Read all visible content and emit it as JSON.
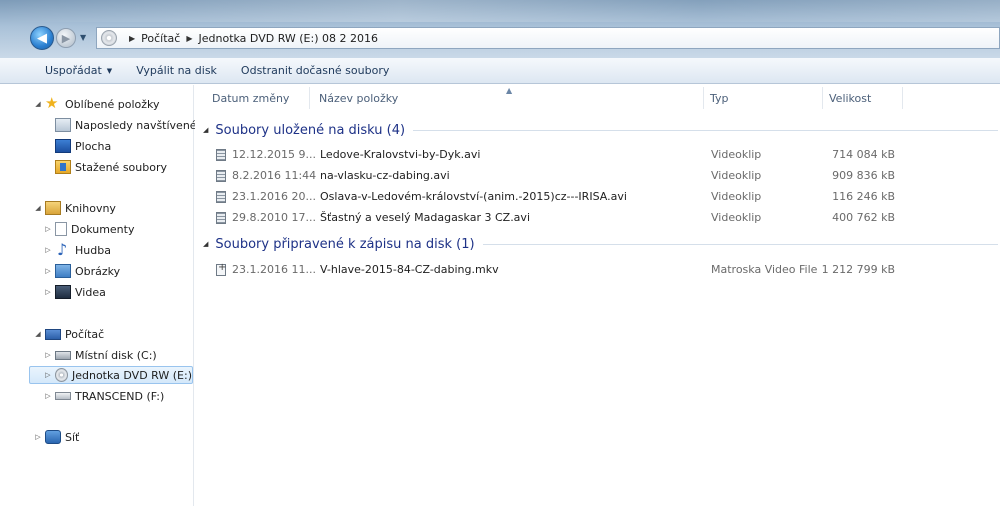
{
  "address": {
    "crumbs": [
      "Počítač",
      "Jednotka DVD RW (E:) 08 2 2016"
    ]
  },
  "toolbar": {
    "organize": "Uspořádat",
    "burn": "Vypálit na disk",
    "delete_temp": "Odstranit dočasné soubory"
  },
  "nav": {
    "favorites": {
      "label": "Oblíbené položky",
      "items": [
        {
          "label": "Naposledy navštívené",
          "icon": "recent-places-icon"
        },
        {
          "label": "Plocha",
          "icon": "desktop-icon"
        },
        {
          "label": "Stažené soubory",
          "icon": "downloads-icon"
        }
      ]
    },
    "libraries": {
      "label": "Knihovny",
      "items": [
        {
          "label": "Dokumenty",
          "icon": "documents-icon"
        },
        {
          "label": "Hudba",
          "icon": "music-icon"
        },
        {
          "label": "Obrázky",
          "icon": "pictures-icon"
        },
        {
          "label": "Videa",
          "icon": "videos-icon"
        }
      ]
    },
    "computer": {
      "label": "Počítač",
      "items": [
        {
          "label": "Místní disk (C:)",
          "icon": "local-disk-icon"
        },
        {
          "label": "Jednotka DVD RW (E:)",
          "icon": "dvd-drive-icon",
          "selected": true
        },
        {
          "label": "TRANSCEND (F:)",
          "icon": "usb-drive-icon"
        }
      ]
    },
    "network": {
      "label": "Síť"
    }
  },
  "columns": {
    "date": "Datum změny",
    "name": "Název položky",
    "type": "Typ",
    "size": "Velikost"
  },
  "groups": [
    {
      "title": "Soubory uložené na disku (4)",
      "rows": [
        {
          "date": "12.12.2015 9...",
          "name": "Ledove-Kralovstvi-by-Dyk.avi",
          "type": "Videoklip",
          "size": "714 084 kB"
        },
        {
          "date": "8.2.2016 11:44",
          "name": "na-vlasku-cz-dabing.avi",
          "type": "Videoklip",
          "size": "909 836 kB"
        },
        {
          "date": "23.1.2016 20...",
          "name": "Oslava-v-Ledovém-království-(anim.-2015)cz---IRISA.avi",
          "type": "Videoklip",
          "size": "116 246 kB"
        },
        {
          "date": "29.8.2010 17...",
          "name": "Šťastný a veselý Madagaskar 3 CZ.avi",
          "type": "Videoklip",
          "size": "400 762 kB"
        }
      ]
    },
    {
      "title": "Soubory připravené k zápisu na disk (1)",
      "rows": [
        {
          "date": "23.1.2016 11...",
          "name": "V-hlave-2015-84-CZ-dabing.mkv",
          "type": "Matroska Video File",
          "size": "1 212 799 kB"
        }
      ]
    }
  ]
}
